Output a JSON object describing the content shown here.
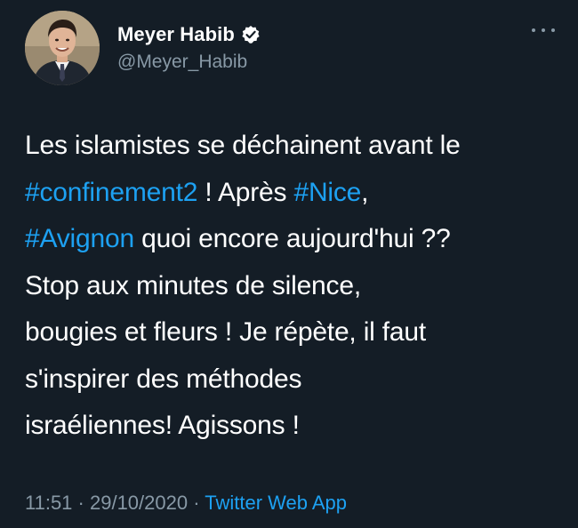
{
  "user": {
    "display_name": "Meyer Habib",
    "handle": "@Meyer_Habib",
    "verified": true,
    "avatar_icon": "profile-photo"
  },
  "tweet": {
    "lines": [
      [
        {
          "text": "Les islamistes se déchainent avant le",
          "hashtag": false
        }
      ],
      [
        {
          "text": "#confinement2",
          "hashtag": true
        },
        {
          "text": " ! Après ",
          "hashtag": false
        },
        {
          "text": "#Nice",
          "hashtag": true
        },
        {
          "text": ",",
          "hashtag": false
        }
      ],
      [
        {
          "text": "#Avignon",
          "hashtag": true
        },
        {
          "text": " quoi encore aujourd'hui ??",
          "hashtag": false
        }
      ],
      [
        {
          "text": "Stop aux minutes de silence,",
          "hashtag": false
        }
      ],
      [
        {
          "text": "bougies et fleurs ! Je répète, il faut",
          "hashtag": false
        }
      ],
      [
        {
          "text": "s'inspirer des méthodes",
          "hashtag": false
        }
      ],
      [
        {
          "text": "israéliennes! Agissons !",
          "hashtag": false
        }
      ]
    ]
  },
  "meta": {
    "time": "11:51",
    "separator": " · ",
    "date": "29/10/2020",
    "source": "Twitter Web App"
  },
  "colors": {
    "background": "#141d26",
    "hashtag": "#1da1f2",
    "muted": "#8899a6",
    "text": "#ffffff"
  },
  "icons": {
    "more": "more-dots-icon",
    "verified": "verified-badge-icon"
  }
}
